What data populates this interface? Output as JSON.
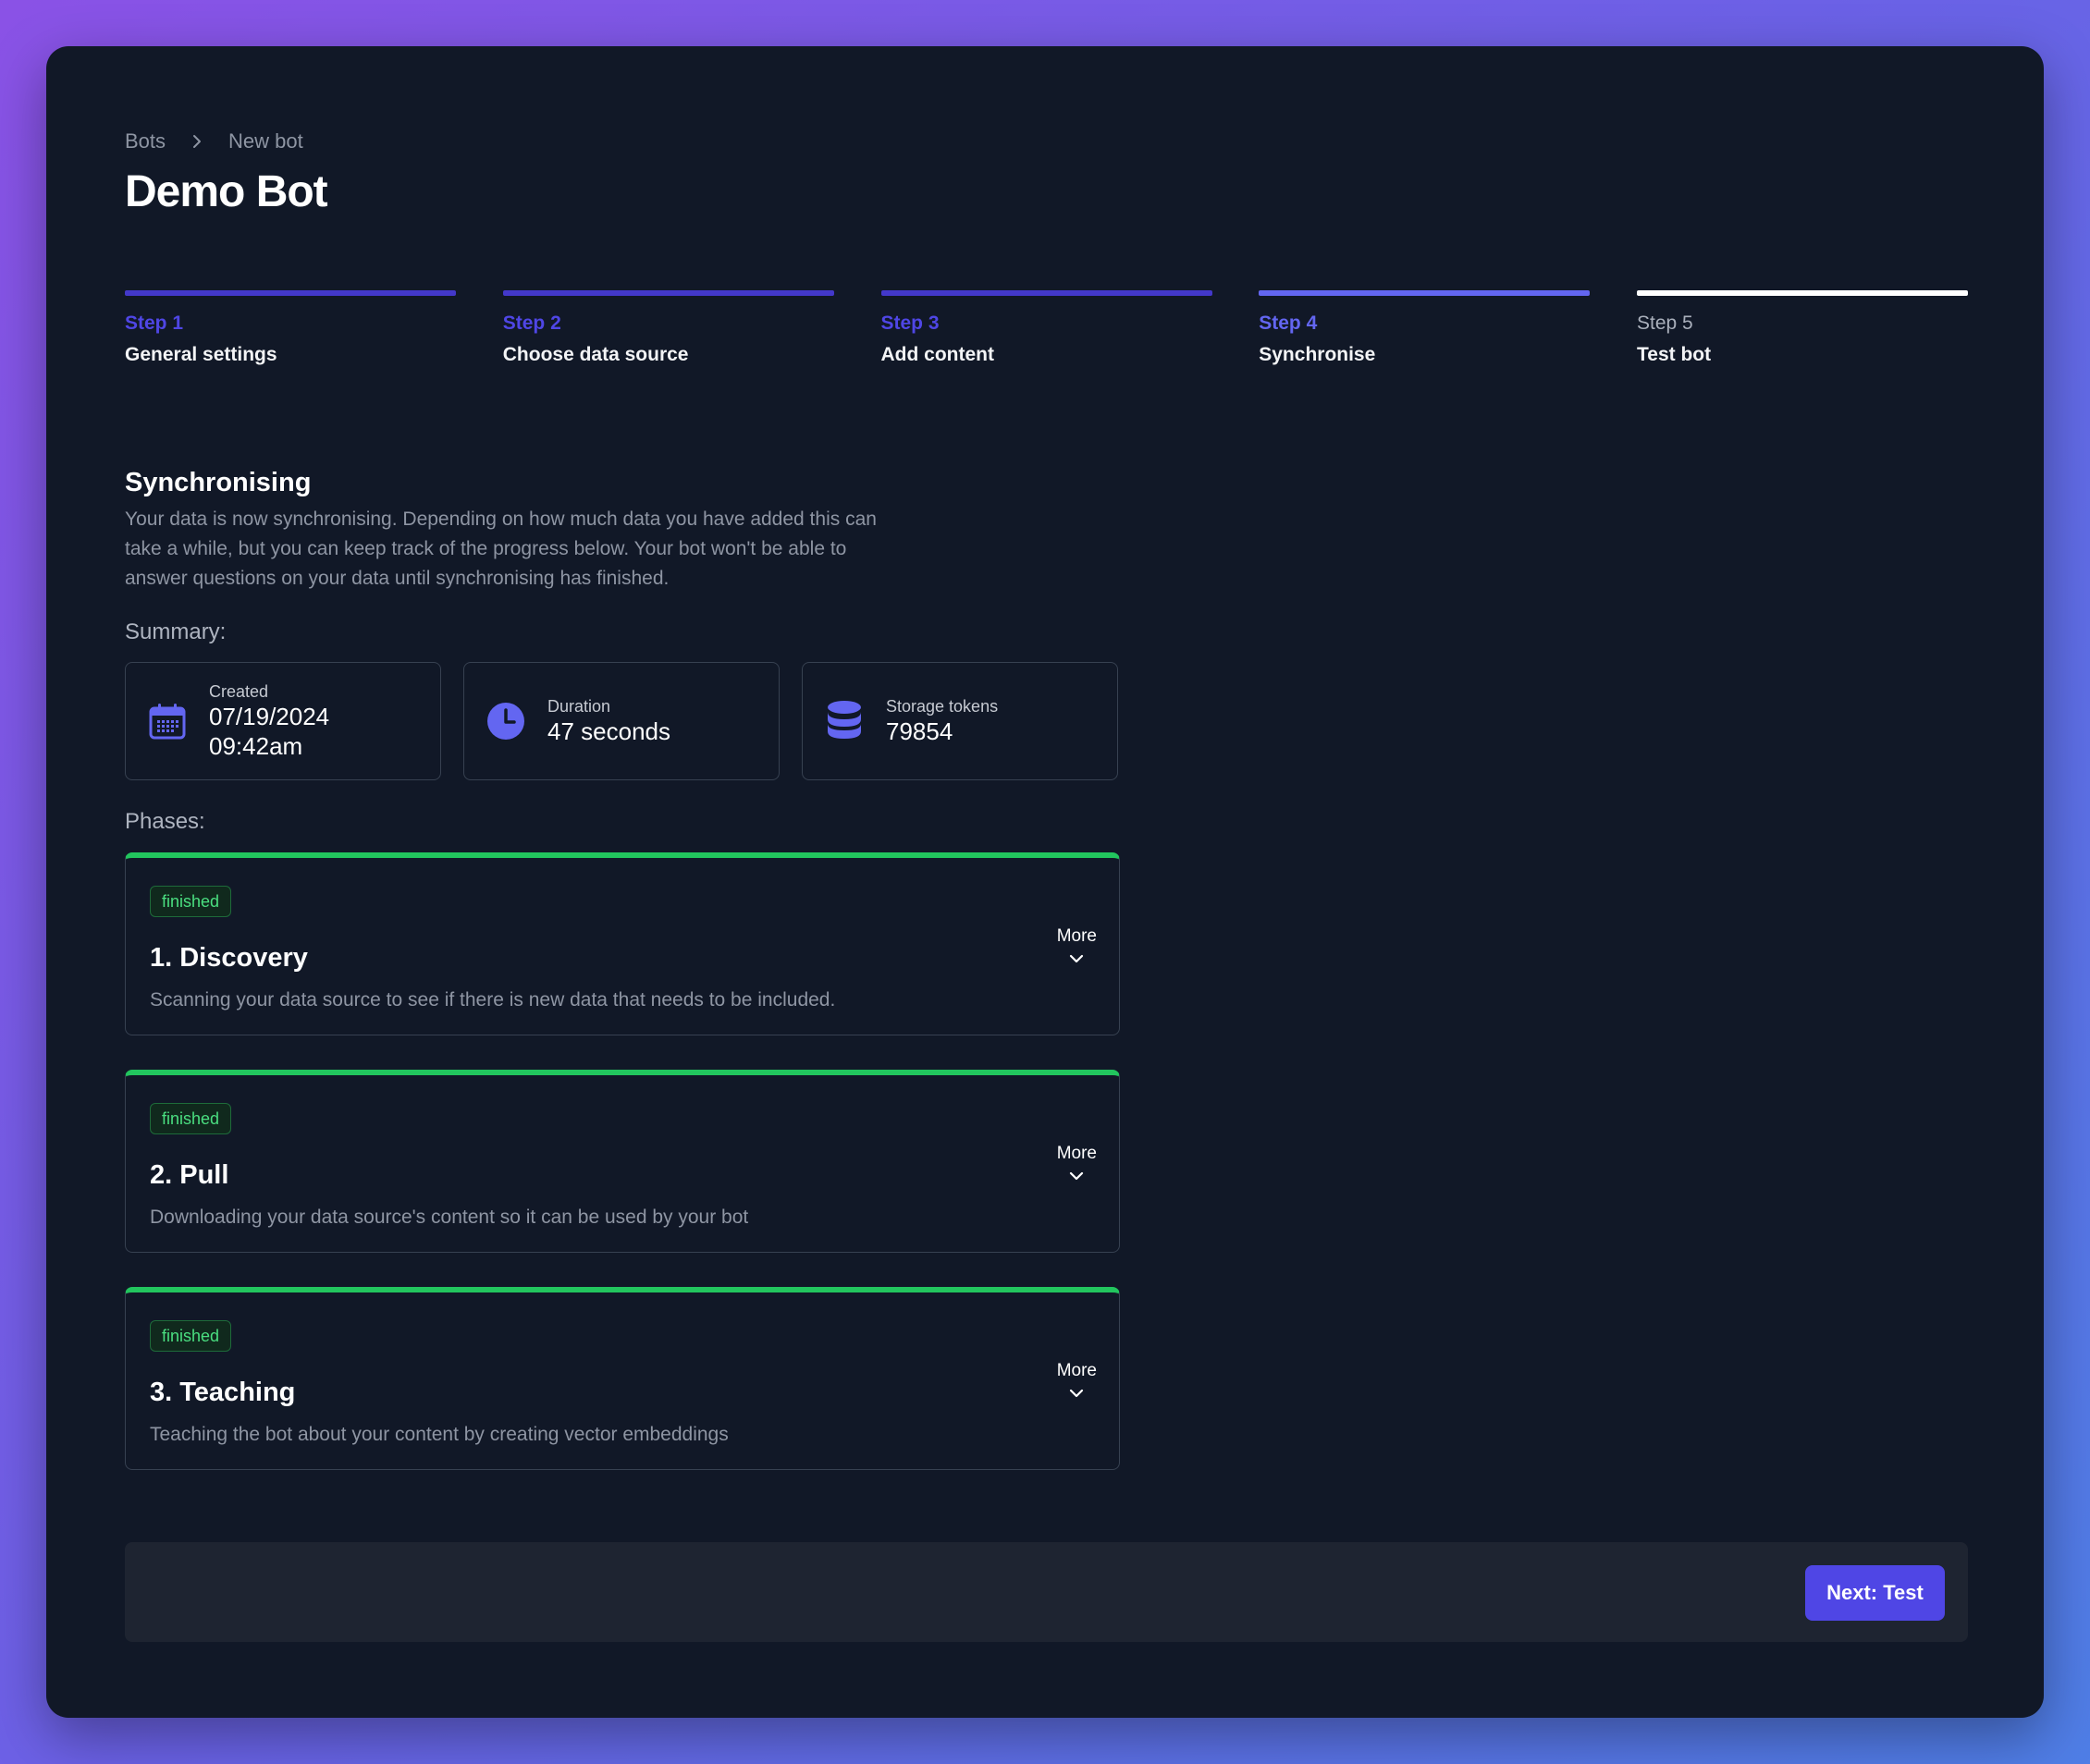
{
  "breadcrumb": {
    "root": "Bots",
    "current": "New bot"
  },
  "page_title": "Demo Bot",
  "steps": [
    {
      "num": "Step 1",
      "name": "General settings",
      "state": "done"
    },
    {
      "num": "Step 2",
      "name": "Choose data source",
      "state": "done"
    },
    {
      "num": "Step 3",
      "name": "Add content",
      "state": "done"
    },
    {
      "num": "Step 4",
      "name": "Synchronise",
      "state": "current"
    },
    {
      "num": "Step 5",
      "name": "Test bot",
      "state": "todo"
    }
  ],
  "sync": {
    "title": "Synchronising",
    "description": "Your data is now synchronising. Depending on how much data you have added this can take a while, but you can keep track of the progress below. Your bot won't be able to answer questions on your data until synchronising has finished."
  },
  "summary": {
    "label": "Summary:",
    "created": {
      "label": "Created",
      "date": "07/19/2024",
      "time": "09:42am",
      "icon": "calendar-icon"
    },
    "duration": {
      "label": "Duration",
      "value": "47 seconds",
      "icon": "clock-icon"
    },
    "storage": {
      "label": "Storage tokens",
      "value": "79854",
      "icon": "database-icon"
    }
  },
  "phases_label": "Phases:",
  "phases": [
    {
      "status": "finished",
      "title": "1. Discovery",
      "description": "Scanning your data source to see if there is new data that needs to be included.",
      "more": "More"
    },
    {
      "status": "finished",
      "title": "2. Pull",
      "description": "Downloading your data source's content so it can be used by your bot",
      "more": "More"
    },
    {
      "status": "finished",
      "title": "3. Teaching",
      "description": "Teaching the bot about your content by creating vector embeddings",
      "more": "More"
    }
  ],
  "footer": {
    "next_label": "Next: Test"
  },
  "colors": {
    "accent": "#4f46e5",
    "success": "#22c55e",
    "background": "#111827"
  }
}
